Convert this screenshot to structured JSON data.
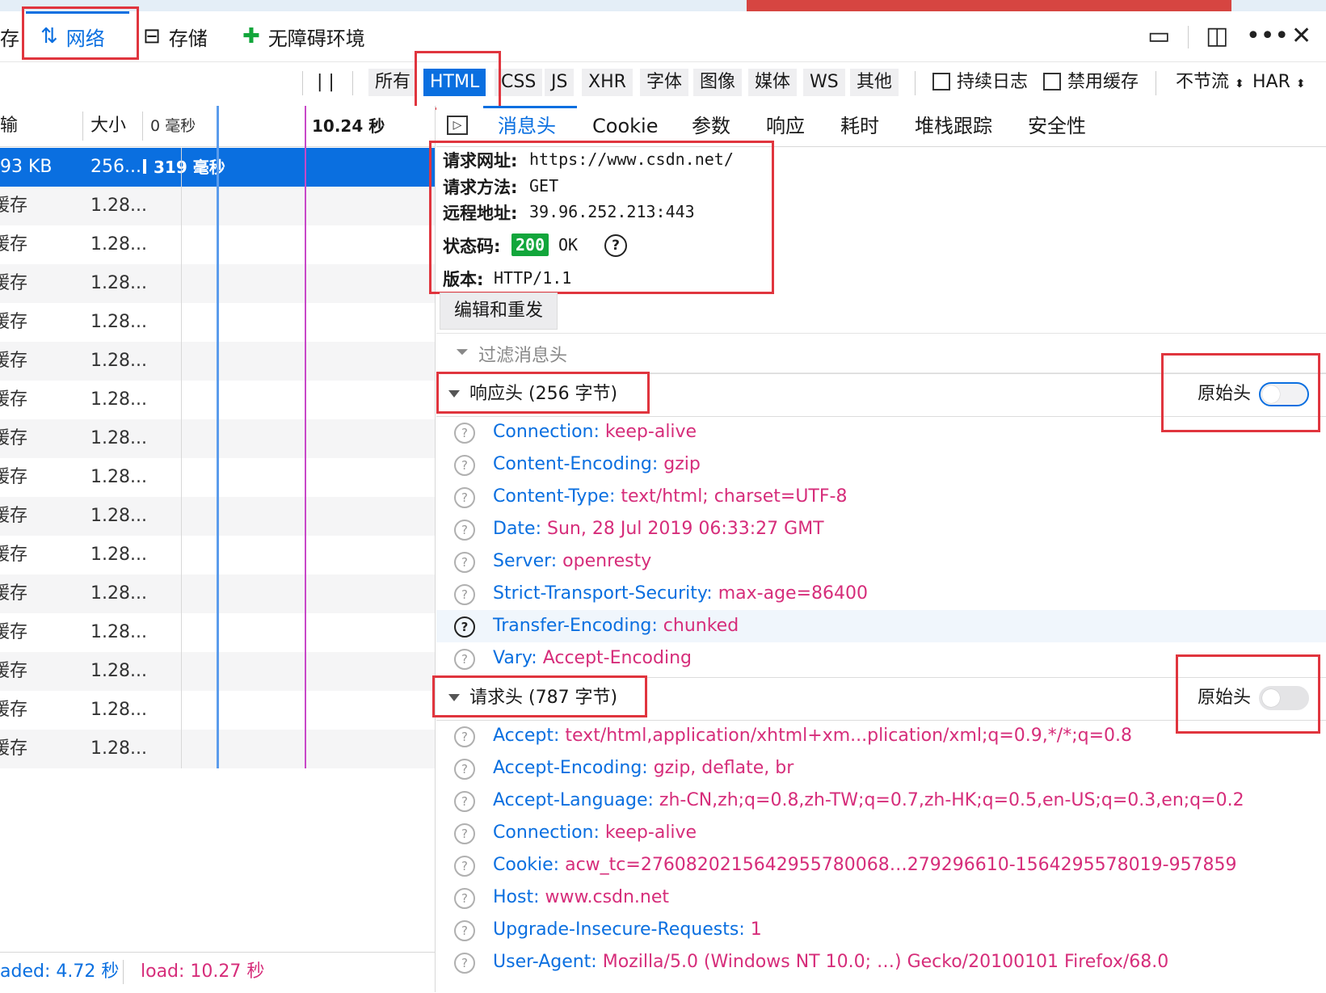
{
  "tabs": [
    {
      "label": "存"
    },
    {
      "label": "网络",
      "icon": "up-down-arrows-icon"
    },
    {
      "label": "存储",
      "icon": "storage-icon"
    },
    {
      "label": "无障碍环境",
      "icon": "accessibility-icon"
    }
  ],
  "filters": {
    "pause": "| |",
    "types": [
      "所有",
      "HTML",
      "CSS",
      "JS",
      "XHR",
      "字体",
      "图像",
      "媒体",
      "WS",
      "其他"
    ],
    "active_type": "HTML",
    "persist_log": "持续日志",
    "disable_cache": "禁用缓存",
    "throttle": "不节流",
    "har": "HAR"
  },
  "list": {
    "headers": {
      "transferred": "输",
      "size": "大小",
      "timeline_start": "0 毫秒",
      "timeline_mark": "10.24 秒"
    },
    "selected_row": {
      "transferred": "93 KB",
      "size": "256....",
      "time": "319 毫秒"
    },
    "rows": [
      {
        "transferred": "缓存",
        "size": "1.28..."
      },
      {
        "transferred": "缓存",
        "size": "1.28..."
      },
      {
        "transferred": "缓存",
        "size": "1.28..."
      },
      {
        "transferred": "缓存",
        "size": "1.28..."
      },
      {
        "transferred": "缓存",
        "size": "1.28..."
      },
      {
        "transferred": "缓存",
        "size": "1.28..."
      },
      {
        "transferred": "缓存",
        "size": "1.28..."
      },
      {
        "transferred": "缓存",
        "size": "1.28..."
      },
      {
        "transferred": "缓存",
        "size": "1.28..."
      },
      {
        "transferred": "缓存",
        "size": "1.28..."
      },
      {
        "transferred": "缓存",
        "size": "1.28..."
      },
      {
        "transferred": "缓存",
        "size": "1.28..."
      },
      {
        "transferred": "缓存",
        "size": "1.28..."
      },
      {
        "transferred": "缓存",
        "size": "1.28..."
      },
      {
        "transferred": "缓存",
        "size": "1.28..."
      }
    ],
    "status": {
      "domcontent": "aded: 4.72 秒",
      "load": "load: 10.27 秒"
    }
  },
  "detail": {
    "subtabs": [
      "消息头",
      "Cookie",
      "参数",
      "响应",
      "耗时",
      "堆栈跟踪",
      "安全性"
    ],
    "summary": {
      "url_label": "请求网址:",
      "url": "https://www.csdn.net/",
      "method_label": "请求方法:",
      "method": "GET",
      "remote_label": "远程地址:",
      "remote": "39.96.252.213:443",
      "status_label": "状态码:",
      "status_code": "200",
      "status_text": "OK",
      "version_label": "版本:",
      "version": "HTTP/1.1"
    },
    "edit_resend": "编辑和重发",
    "filter_placeholder": "过滤消息头",
    "raw_label": "原始头",
    "response_title": "响应头 (256 字节)",
    "response_headers": [
      {
        "name": "Connection:",
        "value": "keep-alive"
      },
      {
        "name": "Content-Encoding:",
        "value": "gzip"
      },
      {
        "name": "Content-Type:",
        "value": "text/html; charset=UTF-8"
      },
      {
        "name": "Date:",
        "value": "Sun, 28 Jul 2019 06:33:27 GMT"
      },
      {
        "name": "Server:",
        "value": "openresty"
      },
      {
        "name": "Strict-Transport-Security:",
        "value": "max-age=86400"
      },
      {
        "name": "Transfer-Encoding:",
        "value": "chunked"
      },
      {
        "name": "Vary:",
        "value": "Accept-Encoding"
      }
    ],
    "request_title": "请求头 (787 字节)",
    "request_headers": [
      {
        "name": "Accept:",
        "value": "text/html,application/xhtml+xm...plication/xml;q=0.9,*/*;q=0.8"
      },
      {
        "name": "Accept-Encoding:",
        "value": "gzip, deflate, br"
      },
      {
        "name": "Accept-Language:",
        "value": "zh-CN,zh;q=0.8,zh-TW;q=0.7,zh-HK;q=0.5,en-US;q=0.3,en;q=0.2"
      },
      {
        "name": "Connection:",
        "value": "keep-alive"
      },
      {
        "name": "Cookie:",
        "value": "acw_tc=2760820215642955780068…279296610-1564295578019-957859"
      },
      {
        "name": "Host:",
        "value": "www.csdn.net"
      },
      {
        "name": "Upgrade-Insecure-Requests:",
        "value": "1"
      },
      {
        "name": "User-Agent:",
        "value": "Mozilla/5.0 (Windows NT 10.0; …) Gecko/20100101 Firefox/68.0"
      }
    ]
  },
  "colors": {
    "accent": "#0a6fe0",
    "highlight": "#e0353e",
    "value": "#d62d7a",
    "ok": "#12a63b"
  }
}
